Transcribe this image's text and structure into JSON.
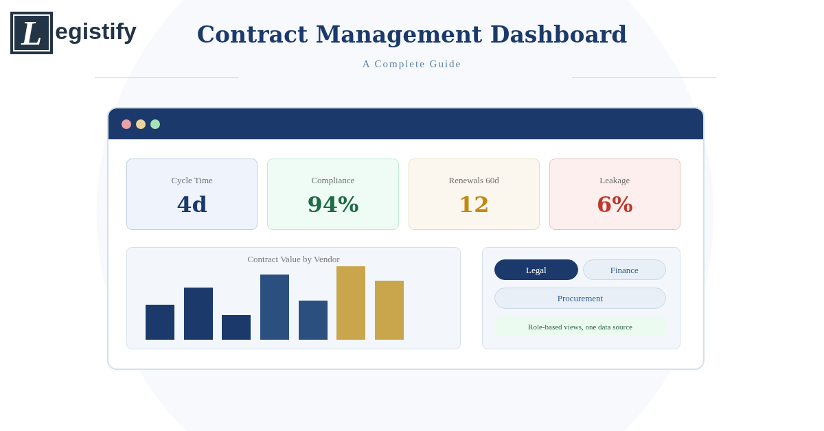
{
  "logo": {
    "letter": "L",
    "wordmark": "egistify"
  },
  "header": {
    "title": "Contract Management Dashboard",
    "subtitle": "A Complete Guide"
  },
  "kpis": [
    {
      "label": "Cycle Time",
      "value": "4d",
      "color": "#1b3a6b"
    },
    {
      "label": "Compliance",
      "value": "94%",
      "color": "#1e6b45"
    },
    {
      "label": "Renewals 60d",
      "value": "12",
      "color": "#c08a12"
    },
    {
      "label": "Leakage",
      "value": "6%",
      "color": "#c0392b"
    }
  ],
  "chart": {
    "title": "Contract Value by Vendor"
  },
  "views": {
    "tabs": [
      {
        "label": "Legal",
        "selected": true
      },
      {
        "label": "Finance",
        "selected": false
      },
      {
        "label": "Procurement",
        "selected": false
      }
    ],
    "note": "Role-based views, one data source"
  }
}
